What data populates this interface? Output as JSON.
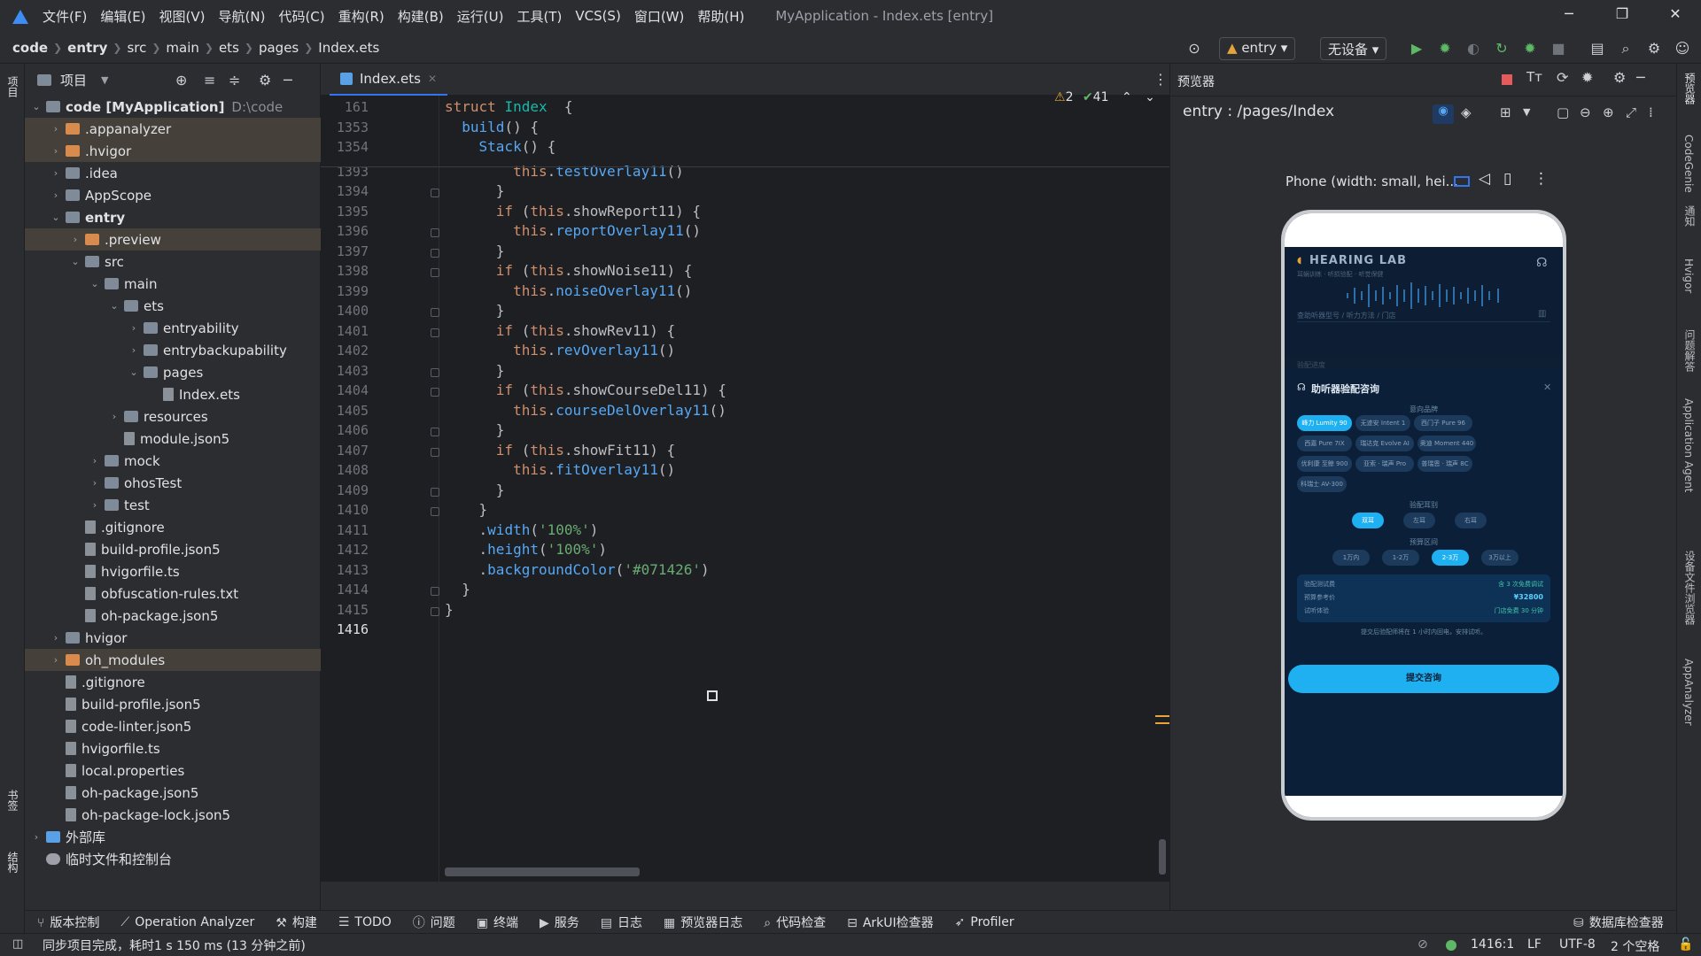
{
  "menubar": {
    "items": [
      "文件(F)",
      "编辑(E)",
      "视图(V)",
      "导航(N)",
      "代码(C)",
      "重构(R)",
      "构建(B)",
      "运行(U)",
      "工具(T)",
      "VCS(S)",
      "窗口(W)",
      "帮助(H)"
    ],
    "window_title": "MyApplication - Index.ets [entry]"
  },
  "breadcrumb": [
    "code",
    "entry",
    "src",
    "main",
    "ets",
    "pages",
    "Index.ets"
  ],
  "toolbar": {
    "module": "entry",
    "device": "无设备"
  },
  "left_strip": {
    "project": "项目",
    "bookmarks": "书签",
    "structure": "结构"
  },
  "project_panel": {
    "title": "项目"
  },
  "tree": [
    {
      "label": "code [MyApplication]",
      "path": "D:\\code",
      "depth": 0,
      "type": "folder",
      "open": true
    },
    {
      "label": ".appanalyzer",
      "depth": 1,
      "type": "folder-o",
      "hl": true
    },
    {
      "label": ".hvigor",
      "depth": 1,
      "type": "folder-o",
      "hl": true
    },
    {
      "label": ".idea",
      "depth": 1,
      "type": "folder"
    },
    {
      "label": "AppScope",
      "depth": 1,
      "type": "folder"
    },
    {
      "label": "entry",
      "depth": 1,
      "type": "folder",
      "open": true,
      "bold": true
    },
    {
      "label": ".preview",
      "depth": 2,
      "type": "folder-o",
      "hl": true
    },
    {
      "label": "src",
      "depth": 2,
      "type": "folder",
      "open": true
    },
    {
      "label": "main",
      "depth": 3,
      "type": "folder",
      "open": true
    },
    {
      "label": "ets",
      "depth": 4,
      "type": "folder",
      "open": true
    },
    {
      "label": "entryability",
      "depth": 5,
      "type": "folder"
    },
    {
      "label": "entrybackupability",
      "depth": 5,
      "type": "folder"
    },
    {
      "label": "pages",
      "depth": 5,
      "type": "folder",
      "open": true
    },
    {
      "label": "Index.ets",
      "depth": 6,
      "type": "file"
    },
    {
      "label": "resources",
      "depth": 4,
      "type": "folder"
    },
    {
      "label": "module.json5",
      "depth": 4,
      "type": "file"
    },
    {
      "label": "mock",
      "depth": 3,
      "type": "folder"
    },
    {
      "label": "ohosTest",
      "depth": 3,
      "type": "folder"
    },
    {
      "label": "test",
      "depth": 3,
      "type": "folder"
    },
    {
      "label": ".gitignore",
      "depth": 2,
      "type": "file"
    },
    {
      "label": "build-profile.json5",
      "depth": 2,
      "type": "file"
    },
    {
      "label": "hvigorfile.ts",
      "depth": 2,
      "type": "file"
    },
    {
      "label": "obfuscation-rules.txt",
      "depth": 2,
      "type": "file"
    },
    {
      "label": "oh-package.json5",
      "depth": 2,
      "type": "file"
    },
    {
      "label": "hvigor",
      "depth": 1,
      "type": "folder"
    },
    {
      "label": "oh_modules",
      "depth": 1,
      "type": "folder-o",
      "hl": true
    },
    {
      "label": ".gitignore",
      "depth": 1,
      "type": "file"
    },
    {
      "label": "build-profile.json5",
      "depth": 1,
      "type": "file"
    },
    {
      "label": "code-linter.json5",
      "depth": 1,
      "type": "file"
    },
    {
      "label": "hvigorfile.ts",
      "depth": 1,
      "type": "file"
    },
    {
      "label": "local.properties",
      "depth": 1,
      "type": "file"
    },
    {
      "label": "oh-package.json5",
      "depth": 1,
      "type": "file"
    },
    {
      "label": "oh-package-lock.json5",
      "depth": 1,
      "type": "file"
    },
    {
      "label": "外部库",
      "depth": 0,
      "type": "lib"
    },
    {
      "label": "临时文件和控制台",
      "depth": 0,
      "type": "scratch"
    }
  ],
  "editor": {
    "tab": "Index.ets",
    "warnings": "2",
    "checks": "41",
    "lines": [
      {
        "n": "161",
        "c": [
          [
            "k",
            "struct "
          ],
          [
            "ty",
            "Index"
          ],
          [
            "",
            "  {"
          ]
        ]
      },
      {
        "n": "1353",
        "c": [
          [
            "f",
            "  build"
          ],
          [
            "",
            "() {"
          ]
        ]
      },
      {
        "n": "1354",
        "c": [
          [
            "f",
            "    Stack"
          ],
          [
            "",
            "() {"
          ]
        ]
      },
      {
        "n": "1393",
        "c": [
          [
            "k",
            "        this"
          ],
          [
            "",
            "."
          ],
          [
            "f",
            "testOverlay11"
          ],
          [
            "",
            "()"
          ]
        ]
      },
      {
        "n": "1394",
        "c": [
          [
            "",
            "      }"
          ]
        ]
      },
      {
        "n": "1395",
        "c": [
          [
            "k",
            "      if "
          ],
          [
            "",
            "("
          ],
          [
            "k",
            "this"
          ],
          [
            "",
            ".showReport11) {"
          ]
        ]
      },
      {
        "n": "1396",
        "c": [
          [
            "k",
            "        this"
          ],
          [
            "",
            "."
          ],
          [
            "f",
            "reportOverlay11"
          ],
          [
            "",
            "()"
          ]
        ]
      },
      {
        "n": "1397",
        "c": [
          [
            "",
            "      }"
          ]
        ]
      },
      {
        "n": "1398",
        "c": [
          [
            "k",
            "      if "
          ],
          [
            "",
            "("
          ],
          [
            "k",
            "this"
          ],
          [
            "",
            ".showNoise11) {"
          ]
        ]
      },
      {
        "n": "1399",
        "c": [
          [
            "k",
            "        this"
          ],
          [
            "",
            "."
          ],
          [
            "f",
            "noiseOverlay11"
          ],
          [
            "",
            "()"
          ]
        ]
      },
      {
        "n": "1400",
        "c": [
          [
            "",
            "      }"
          ]
        ]
      },
      {
        "n": "1401",
        "c": [
          [
            "k",
            "      if "
          ],
          [
            "",
            "("
          ],
          [
            "k",
            "this"
          ],
          [
            "",
            ".showRev11) {"
          ]
        ]
      },
      {
        "n": "1402",
        "c": [
          [
            "k",
            "        this"
          ],
          [
            "",
            "."
          ],
          [
            "f",
            "revOverlay11"
          ],
          [
            "",
            "()"
          ]
        ]
      },
      {
        "n": "1403",
        "c": [
          [
            "",
            "      }"
          ]
        ]
      },
      {
        "n": "1404",
        "c": [
          [
            "k",
            "      if "
          ],
          [
            "",
            "("
          ],
          [
            "k",
            "this"
          ],
          [
            "",
            ".showCourseDel11) {"
          ]
        ]
      },
      {
        "n": "1405",
        "c": [
          [
            "k",
            "        this"
          ],
          [
            "",
            "."
          ],
          [
            "f",
            "courseDelOverlay11"
          ],
          [
            "",
            "()"
          ]
        ]
      },
      {
        "n": "1406",
        "c": [
          [
            "",
            "      }"
          ]
        ]
      },
      {
        "n": "1407",
        "c": [
          [
            "k",
            "      if "
          ],
          [
            "",
            "("
          ],
          [
            "k",
            "this"
          ],
          [
            "",
            ".showFit11) {"
          ]
        ]
      },
      {
        "n": "1408",
        "c": [
          [
            "k",
            "        this"
          ],
          [
            "",
            "."
          ],
          [
            "f",
            "fitOverlay11"
          ],
          [
            "",
            "()"
          ]
        ]
      },
      {
        "n": "1409",
        "c": [
          [
            "",
            "      }"
          ]
        ]
      },
      {
        "n": "1410",
        "c": [
          [
            "",
            "    }"
          ]
        ]
      },
      {
        "n": "1411",
        "c": [
          [
            "",
            "    ."
          ],
          [
            "f",
            "width"
          ],
          [
            "",
            "("
          ],
          [
            "s",
            "'100%'"
          ],
          [
            "",
            ")"
          ]
        ]
      },
      {
        "n": "1412",
        "c": [
          [
            "",
            "    ."
          ],
          [
            "f",
            "height"
          ],
          [
            "",
            "("
          ],
          [
            "s",
            "'100%'"
          ],
          [
            "",
            ")"
          ]
        ]
      },
      {
        "n": "1413",
        "c": [
          [
            "",
            "    ."
          ],
          [
            "f",
            "backgroundColor"
          ],
          [
            "",
            "("
          ],
          [
            "s",
            "'#071426'"
          ],
          [
            "",
            ")"
          ]
        ]
      },
      {
        "n": "1414",
        "c": [
          [
            "",
            "  }"
          ]
        ]
      },
      {
        "n": "1415",
        "c": [
          [
            "",
            "}"
          ]
        ]
      },
      {
        "n": "1416",
        "c": [
          [
            "",
            ""
          ]
        ]
      }
    ]
  },
  "preview": {
    "title": "预览器",
    "route": "entry : /pages/Index",
    "device": "Phone (width: small, hei...",
    "app": {
      "brand": "HEARING LAB",
      "subtitle": "耳蜗训练 · 听损验配 · 听觉保健",
      "search_hint": "查助听器型号 / 听力方法 / 门店",
      "section_hint": "验配进度",
      "modal_title": "助听器验配咨询",
      "brand_label": "意向品牌",
      "brands": [
        "峰力 Lumity 90",
        "无迹安 Intent 1",
        "西门子 Pure 96",
        "西嘉 Pure 7IX",
        "瑞达克 Evolve AI 20",
        "奥迪 Moment 440",
        "优利康 至鲸 900",
        "亚索 · 瑞声 Pro",
        "普瑞恩 · 瑞声 8C",
        "科瑞士 AV-300"
      ],
      "ear_label": "验配耳别",
      "ears": [
        "双耳",
        "左耳",
        "右耳"
      ],
      "budget_label": "预算区间",
      "budgets": [
        "1万内",
        "1-2万",
        "2-3万",
        "3万以上"
      ],
      "summary": [
        {
          "k": "验配测试费",
          "v": "含 3 次免费调试"
        },
        {
          "k": "预算参考价",
          "v": "¥32800"
        },
        {
          "k": "试听体验",
          "v": "门店免费 30 分钟"
        }
      ],
      "note": "提交后验配师将在 1 小时内回电，安排试听。",
      "submit": "提交咨询"
    }
  },
  "right_strip": {
    "preview": "预览器",
    "codegenie": "CodeGenie",
    "notify": "通知",
    "hvigor": "Hvigor",
    "qa": "问题解答",
    "agent": "Application Agent",
    "device_browser": "设备文件浏览器",
    "appanalyzer": "AppAnalyzer"
  },
  "bottom_tools": [
    "版本控制",
    "Operation Analyzer",
    "构建",
    "TODO",
    "问题",
    "终端",
    "服务",
    "日志",
    "预览器日志",
    "代码检查",
    "ArkUI检查器",
    "Profiler"
  ],
  "bottom_right": "数据库检查器",
  "status": {
    "message": "同步项目完成，耗时1 s 150 ms (13 分钟之前)",
    "position": "1416:1",
    "line_sep": "LF",
    "encoding": "UTF-8",
    "indent": "2 个空格"
  }
}
